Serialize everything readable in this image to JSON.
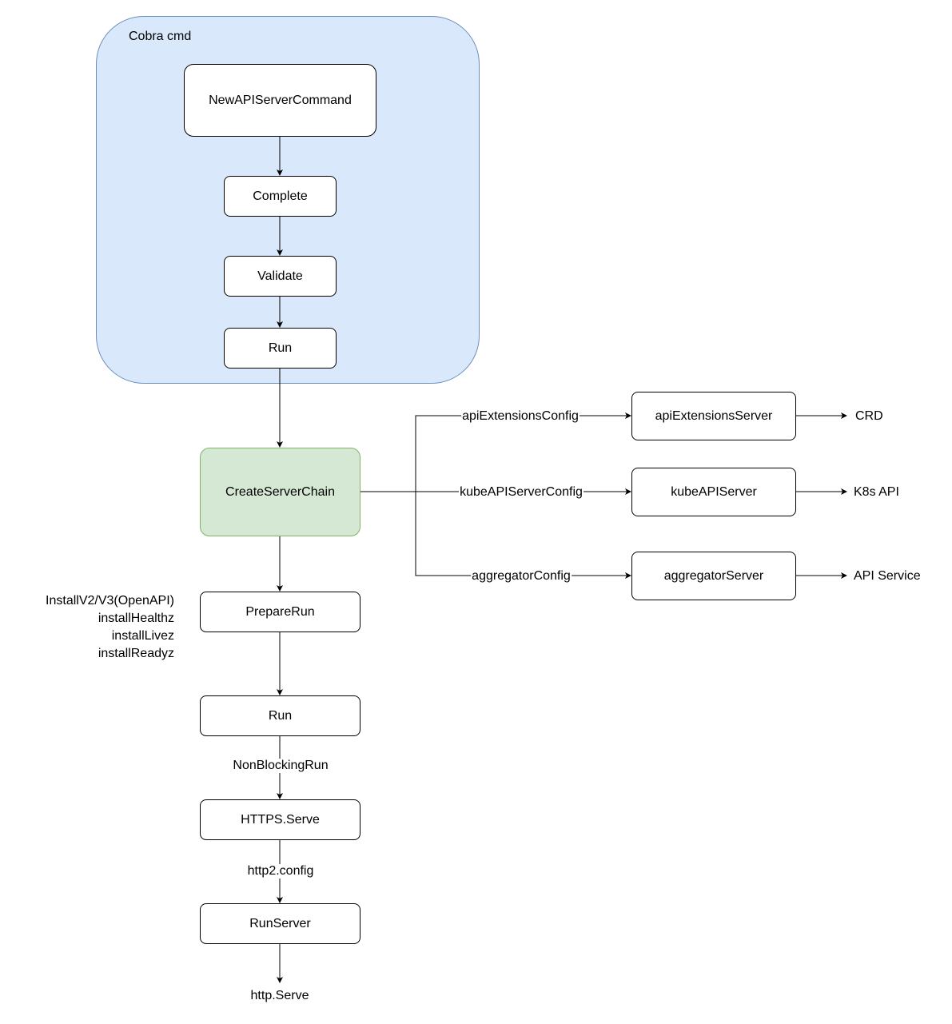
{
  "colors": {
    "container_fill": "#dae8fc",
    "container_stroke": "#6c8ebf",
    "highlight_fill": "#d5e8d4",
    "highlight_stroke": "#82b366"
  },
  "container": {
    "label": "Cobra cmd"
  },
  "nodes": {
    "new_api_server_command": "NewAPIServerCommand",
    "complete": "Complete",
    "validate": "Validate",
    "run_cmd": "Run",
    "create_server_chain": "CreateServerChain",
    "prepare_run": "PrepareRun",
    "run": "Run",
    "https_serve": "HTTPS.Serve",
    "run_server": "RunServer",
    "api_extensions_server": "apiExtensionsServer",
    "kube_api_server": "kubeAPIServer",
    "aggregator_server": "aggregatorServer"
  },
  "edge_labels": {
    "api_extensions_config": "apiExtensionsConfig",
    "kube_api_server_config": "kubeAPIServerConfig",
    "aggregator_config": "aggregatorConfig",
    "non_blocking_run": "NonBlockingRun",
    "http2_config": "http2.config"
  },
  "outputs": {
    "crd": "CRD",
    "k8s_api": "K8s API",
    "api_service": "API Service",
    "http_serve": "http.Serve"
  },
  "prepare_run_notes": [
    "InstallV2/V3(OpenAPI)",
    "installHealthz",
    "installLivez",
    "installReadyz"
  ]
}
